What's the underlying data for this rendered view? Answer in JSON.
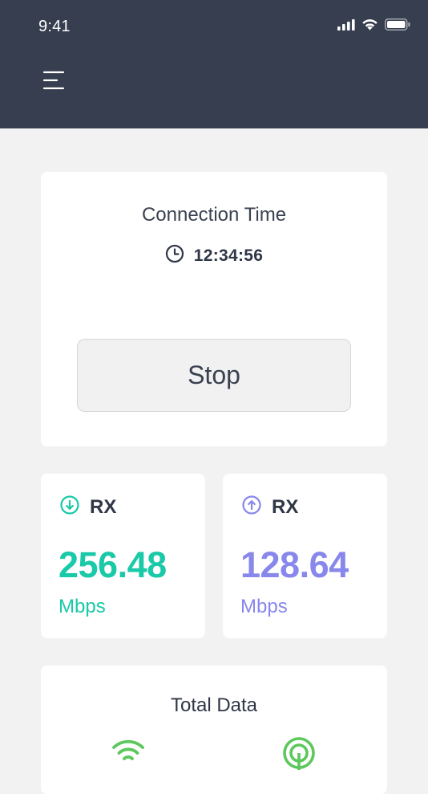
{
  "status_bar": {
    "time": "9:41",
    "icons": [
      "signal-icon",
      "wifi-icon",
      "battery-icon"
    ]
  },
  "header": {
    "menu_icon": "menu-icon",
    "background": "#363e4f"
  },
  "connection": {
    "title": "Connection Time",
    "time": "12:34:56",
    "clock_icon": "clock-icon",
    "stop_label": "Stop"
  },
  "stats": {
    "download": {
      "label": "RX",
      "value": "256.48",
      "unit": "Mbps",
      "icon": "arrow-down-circle-icon",
      "color": "#19c9a8"
    },
    "upload": {
      "label": "RX",
      "value": "128.64",
      "unit": "Mbps",
      "icon": "arrow-up-circle-icon",
      "color": "#8787ec"
    }
  },
  "total": {
    "title": "Total Data",
    "icons": [
      "wifi-icon",
      "target-icon"
    ],
    "accent": "#5cc85c"
  }
}
